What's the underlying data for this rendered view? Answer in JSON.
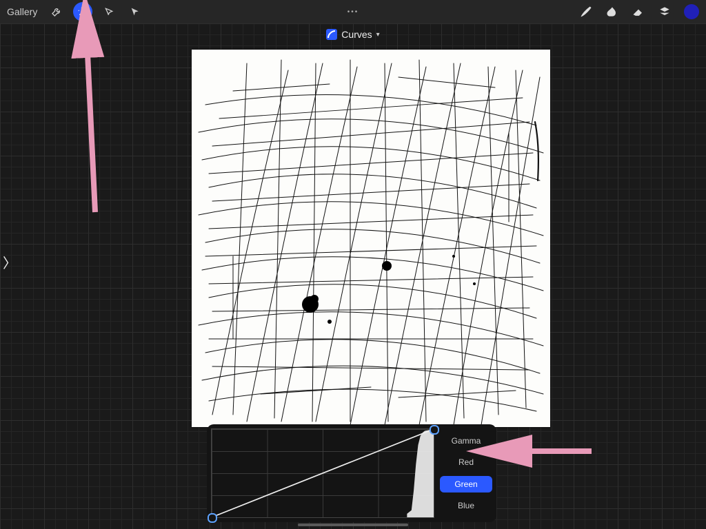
{
  "topbar": {
    "gallery_label": "Gallery",
    "tools": [
      {
        "name": "wrench-icon",
        "active": false
      },
      {
        "name": "wand-icon",
        "active": true
      },
      {
        "name": "selection-icon",
        "active": false
      },
      {
        "name": "cursor-icon",
        "active": false
      }
    ],
    "right_tools": [
      {
        "name": "brush-icon"
      },
      {
        "name": "smudge-icon"
      },
      {
        "name": "eraser-icon"
      },
      {
        "name": "layers-icon"
      }
    ],
    "color": "#2020b8",
    "ellipsis": "•••"
  },
  "panel": {
    "title": "Curves",
    "caret": "▾"
  },
  "curves": {
    "channels": [
      {
        "label": "Gamma",
        "selected": false
      },
      {
        "label": "Red",
        "selected": false
      },
      {
        "label": "Green",
        "selected": true
      },
      {
        "label": "Blue",
        "selected": false
      }
    ]
  },
  "annotations": {
    "arrow_color": "#e89ab8"
  },
  "side_handle": "〉"
}
